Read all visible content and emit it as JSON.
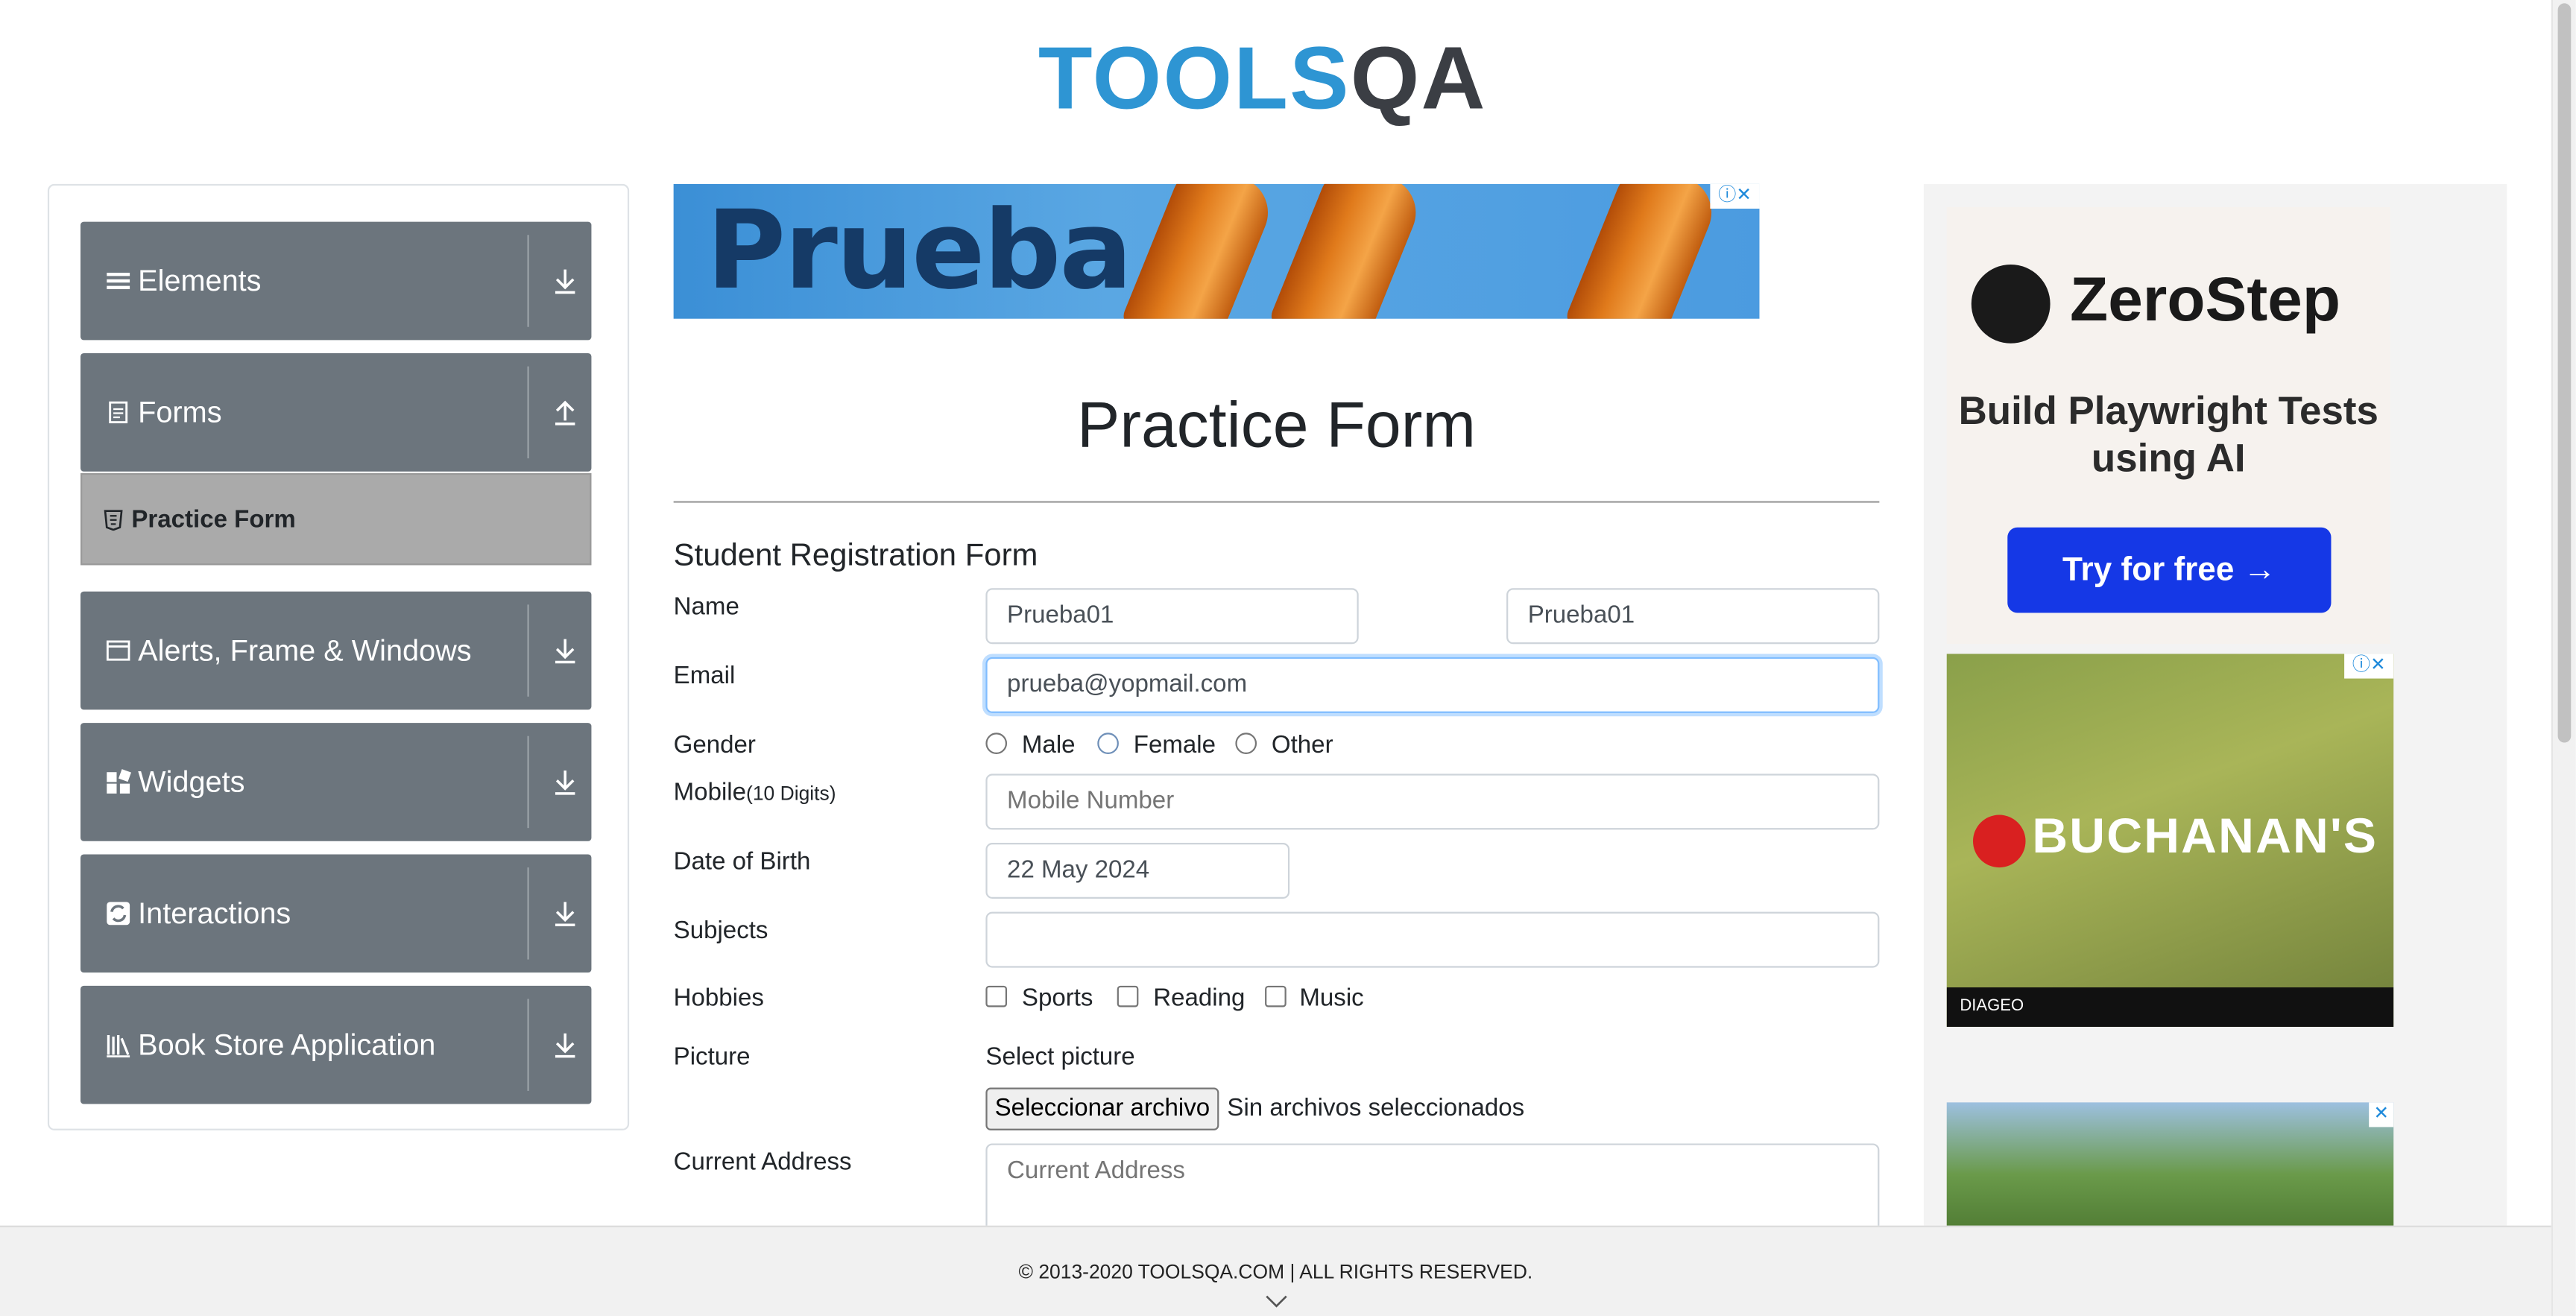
{
  "header": {
    "logo_part1": "TOOLS",
    "logo_part2": "QA"
  },
  "sidebar": {
    "groups": [
      {
        "label": "Elements",
        "icon": "hamburger-icon",
        "arrow": "download-icon"
      },
      {
        "label": "Forms",
        "icon": "document-icon",
        "arrow": "upload-icon"
      },
      {
        "label": "Alerts, Frame & Windows",
        "icon": "window-icon",
        "arrow": "download-icon"
      },
      {
        "label": "Widgets",
        "icon": "widgets-icon",
        "arrow": "download-icon"
      },
      {
        "label": "Interactions",
        "icon": "interactions-icon",
        "arrow": "download-icon"
      },
      {
        "label": "Book Store Application",
        "icon": "books-icon",
        "arrow": "download-icon"
      }
    ],
    "active_item": "Practice Form"
  },
  "banner": {
    "text": "Prueba"
  },
  "main": {
    "title": "Practice Form",
    "form_heading": "Student Registration Form",
    "labels": {
      "name": "Name",
      "email": "Email",
      "gender": "Gender",
      "mobile": "Mobile",
      "mobile_hint": "(10 Digits)",
      "dob": "Date of Birth",
      "subjects": "Subjects",
      "hobbies": "Hobbies",
      "picture": "Picture",
      "address": "Current Address"
    },
    "fields": {
      "first_name": "Prueba01",
      "last_name": "Prueba01",
      "email": "prueba@yopmail.com",
      "mobile_placeholder": "Mobile Number",
      "dob": "22 May 2024",
      "subjects": "",
      "address_placeholder": "Current Address"
    },
    "gender_options": [
      "Male",
      "Female",
      "Other"
    ],
    "hobby_options": [
      "Sports",
      "Reading",
      "Music"
    ],
    "picture": {
      "select_label": "Select picture",
      "button": "Seleccionar archivo",
      "status": "Sin archivos seleccionados"
    }
  },
  "ads": {
    "zerostep": {
      "brand": "ZeroStep",
      "headline": "Build Playwright Tests using AI",
      "cta": "Try for free →"
    },
    "buchanans": {
      "brand": "BUCHANAN'S",
      "footer": "DIAGEO"
    }
  },
  "footer": {
    "text": "© 2013-2020 TOOLSQA.COM | ALL RIGHTS RESERVED."
  },
  "colors": {
    "sidebar_group": "#6c757d",
    "active_item": "#aaaaaa",
    "brand_blue": "#2e95d3",
    "cta_blue": "#1538e6"
  }
}
